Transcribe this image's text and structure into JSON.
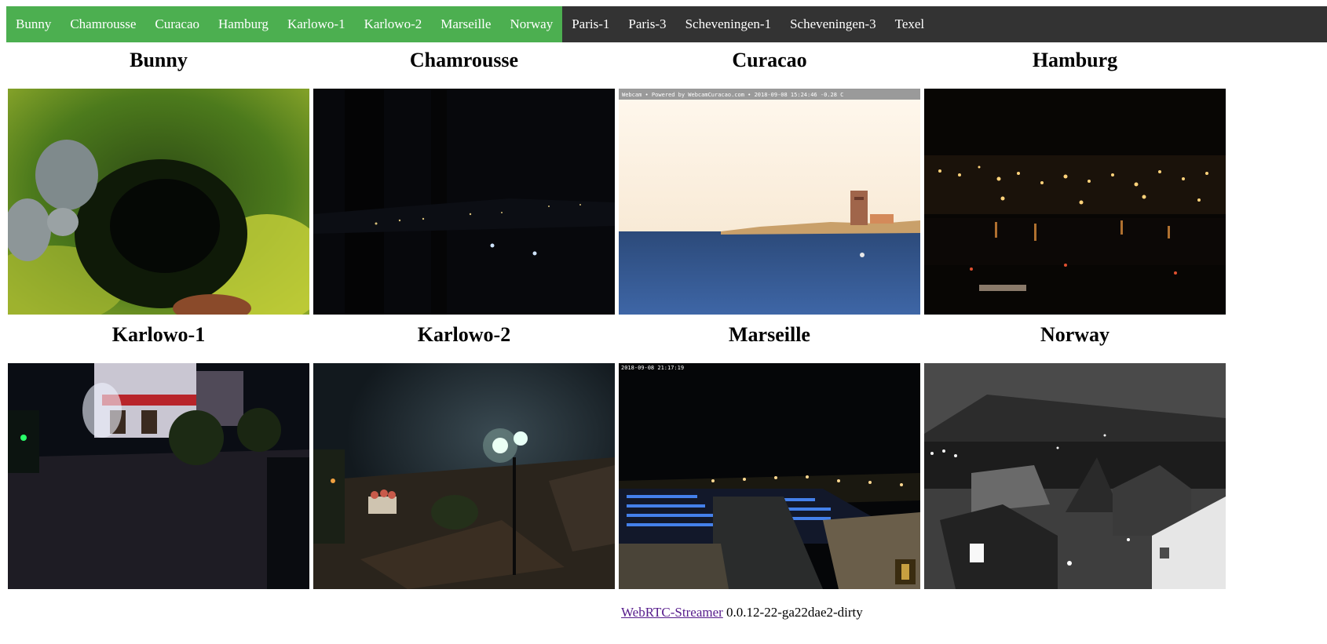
{
  "nav": {
    "items": [
      {
        "label": "Bunny",
        "active": true
      },
      {
        "label": "Chamrousse",
        "active": true
      },
      {
        "label": "Curacao",
        "active": true
      },
      {
        "label": "Hamburg",
        "active": true
      },
      {
        "label": "Karlowo-1",
        "active": true
      },
      {
        "label": "Karlowo-2",
        "active": true
      },
      {
        "label": "Marseille",
        "active": true
      },
      {
        "label": "Norway",
        "active": true
      },
      {
        "label": "Paris-1",
        "active": false
      },
      {
        "label": "Paris-3",
        "active": false
      },
      {
        "label": "Scheveningen-1",
        "active": false
      },
      {
        "label": "Scheveningen-3",
        "active": false
      },
      {
        "label": "Texel",
        "active": false
      }
    ]
  },
  "streams": [
    {
      "title": "Bunny"
    },
    {
      "title": "Chamrousse"
    },
    {
      "title": "Curacao",
      "overlay": "Webcam • Powered by WebcamCuracao.com • 2018-09-08 15:24:46 -0.28 C"
    },
    {
      "title": "Hamburg"
    },
    {
      "title": "Karlowo-1"
    },
    {
      "title": "Karlowo-2"
    },
    {
      "title": "Marseille",
      "overlay": "2018-09-08 21:17:19"
    },
    {
      "title": "Norway"
    }
  ],
  "footer": {
    "link_text": "WebRTC-Streamer",
    "version": " 0.0.12-22-ga22dae2-dirty"
  },
  "colors": {
    "nav_bg": "#333333",
    "nav_active": "#4caf50",
    "link": "#551a8b"
  }
}
